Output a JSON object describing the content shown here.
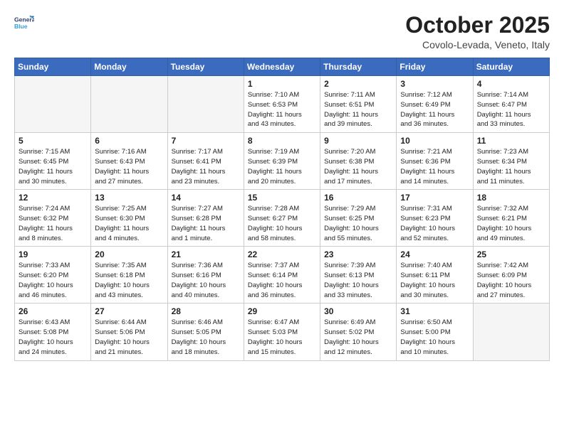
{
  "header": {
    "logo_line1": "General",
    "logo_line2": "Blue",
    "month": "October 2025",
    "location": "Covolo-Levada, Veneto, Italy"
  },
  "weekdays": [
    "Sunday",
    "Monday",
    "Tuesday",
    "Wednesday",
    "Thursday",
    "Friday",
    "Saturday"
  ],
  "weeks": [
    [
      {
        "day": "",
        "info": ""
      },
      {
        "day": "",
        "info": ""
      },
      {
        "day": "",
        "info": ""
      },
      {
        "day": "1",
        "info": "Sunrise: 7:10 AM\nSunset: 6:53 PM\nDaylight: 11 hours\nand 43 minutes."
      },
      {
        "day": "2",
        "info": "Sunrise: 7:11 AM\nSunset: 6:51 PM\nDaylight: 11 hours\nand 39 minutes."
      },
      {
        "day": "3",
        "info": "Sunrise: 7:12 AM\nSunset: 6:49 PM\nDaylight: 11 hours\nand 36 minutes."
      },
      {
        "day": "4",
        "info": "Sunrise: 7:14 AM\nSunset: 6:47 PM\nDaylight: 11 hours\nand 33 minutes."
      }
    ],
    [
      {
        "day": "5",
        "info": "Sunrise: 7:15 AM\nSunset: 6:45 PM\nDaylight: 11 hours\nand 30 minutes."
      },
      {
        "day": "6",
        "info": "Sunrise: 7:16 AM\nSunset: 6:43 PM\nDaylight: 11 hours\nand 27 minutes."
      },
      {
        "day": "7",
        "info": "Sunrise: 7:17 AM\nSunset: 6:41 PM\nDaylight: 11 hours\nand 23 minutes."
      },
      {
        "day": "8",
        "info": "Sunrise: 7:19 AM\nSunset: 6:39 PM\nDaylight: 11 hours\nand 20 minutes."
      },
      {
        "day": "9",
        "info": "Sunrise: 7:20 AM\nSunset: 6:38 PM\nDaylight: 11 hours\nand 17 minutes."
      },
      {
        "day": "10",
        "info": "Sunrise: 7:21 AM\nSunset: 6:36 PM\nDaylight: 11 hours\nand 14 minutes."
      },
      {
        "day": "11",
        "info": "Sunrise: 7:23 AM\nSunset: 6:34 PM\nDaylight: 11 hours\nand 11 minutes."
      }
    ],
    [
      {
        "day": "12",
        "info": "Sunrise: 7:24 AM\nSunset: 6:32 PM\nDaylight: 11 hours\nand 8 minutes."
      },
      {
        "day": "13",
        "info": "Sunrise: 7:25 AM\nSunset: 6:30 PM\nDaylight: 11 hours\nand 4 minutes."
      },
      {
        "day": "14",
        "info": "Sunrise: 7:27 AM\nSunset: 6:28 PM\nDaylight: 11 hours\nand 1 minute."
      },
      {
        "day": "15",
        "info": "Sunrise: 7:28 AM\nSunset: 6:27 PM\nDaylight: 10 hours\nand 58 minutes."
      },
      {
        "day": "16",
        "info": "Sunrise: 7:29 AM\nSunset: 6:25 PM\nDaylight: 10 hours\nand 55 minutes."
      },
      {
        "day": "17",
        "info": "Sunrise: 7:31 AM\nSunset: 6:23 PM\nDaylight: 10 hours\nand 52 minutes."
      },
      {
        "day": "18",
        "info": "Sunrise: 7:32 AM\nSunset: 6:21 PM\nDaylight: 10 hours\nand 49 minutes."
      }
    ],
    [
      {
        "day": "19",
        "info": "Sunrise: 7:33 AM\nSunset: 6:20 PM\nDaylight: 10 hours\nand 46 minutes."
      },
      {
        "day": "20",
        "info": "Sunrise: 7:35 AM\nSunset: 6:18 PM\nDaylight: 10 hours\nand 43 minutes."
      },
      {
        "day": "21",
        "info": "Sunrise: 7:36 AM\nSunset: 6:16 PM\nDaylight: 10 hours\nand 40 minutes."
      },
      {
        "day": "22",
        "info": "Sunrise: 7:37 AM\nSunset: 6:14 PM\nDaylight: 10 hours\nand 36 minutes."
      },
      {
        "day": "23",
        "info": "Sunrise: 7:39 AM\nSunset: 6:13 PM\nDaylight: 10 hours\nand 33 minutes."
      },
      {
        "day": "24",
        "info": "Sunrise: 7:40 AM\nSunset: 6:11 PM\nDaylight: 10 hours\nand 30 minutes."
      },
      {
        "day": "25",
        "info": "Sunrise: 7:42 AM\nSunset: 6:09 PM\nDaylight: 10 hours\nand 27 minutes."
      }
    ],
    [
      {
        "day": "26",
        "info": "Sunrise: 6:43 AM\nSunset: 5:08 PM\nDaylight: 10 hours\nand 24 minutes."
      },
      {
        "day": "27",
        "info": "Sunrise: 6:44 AM\nSunset: 5:06 PM\nDaylight: 10 hours\nand 21 minutes."
      },
      {
        "day": "28",
        "info": "Sunrise: 6:46 AM\nSunset: 5:05 PM\nDaylight: 10 hours\nand 18 minutes."
      },
      {
        "day": "29",
        "info": "Sunrise: 6:47 AM\nSunset: 5:03 PM\nDaylight: 10 hours\nand 15 minutes."
      },
      {
        "day": "30",
        "info": "Sunrise: 6:49 AM\nSunset: 5:02 PM\nDaylight: 10 hours\nand 12 minutes."
      },
      {
        "day": "31",
        "info": "Sunrise: 6:50 AM\nSunset: 5:00 PM\nDaylight: 10 hours\nand 10 minutes."
      },
      {
        "day": "",
        "info": ""
      }
    ]
  ]
}
